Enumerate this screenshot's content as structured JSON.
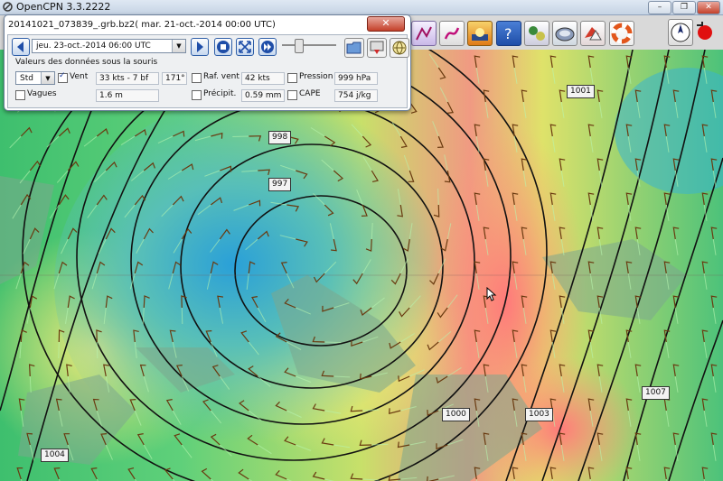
{
  "app": {
    "title": "OpenCPN 3.3.2222"
  },
  "window_buttons": {
    "minimize": "–",
    "restore": "❐",
    "close": "✕"
  },
  "grib_dialog": {
    "title": "20141021_073839_.grb.bz2( mar. 21-oct.-2014 00:00  UTC)",
    "close_label": "✕",
    "timeline_value": "jeu. 23-oct.-2014 06:00  UTC",
    "cursor_data_heading": "Valeurs des données sous la souris",
    "mode_select_value": "Std",
    "wind": {
      "label": "Vent",
      "checked": true,
      "speed": "33 kts -  7 bf",
      "direction": "171°"
    },
    "gust": {
      "label": "Raf. vent",
      "checked": false,
      "value": "42 kts"
    },
    "pressure": {
      "label": "Pression",
      "checked": false,
      "value": "999 hPa"
    },
    "waves": {
      "label": "Vagues",
      "checked": false,
      "value": "1.6 m"
    },
    "precip": {
      "label": "Précipit.",
      "checked": false,
      "value": "0.59 mm"
    },
    "cape": {
      "label": "CAPE",
      "checked": false,
      "value": "754 j/kg"
    }
  },
  "isobars": [
    {
      "label": "1001"
    },
    {
      "label": "998"
    },
    {
      "label": "997"
    },
    {
      "label": "1000"
    },
    {
      "label": "1003"
    },
    {
      "label": "1007"
    },
    {
      "label": "1004"
    }
  ],
  "colors": {
    "toolbar_bg": "#d9d9d9",
    "dialog_close": "#c4402a",
    "accent_blue": "#2f5fa8"
  }
}
